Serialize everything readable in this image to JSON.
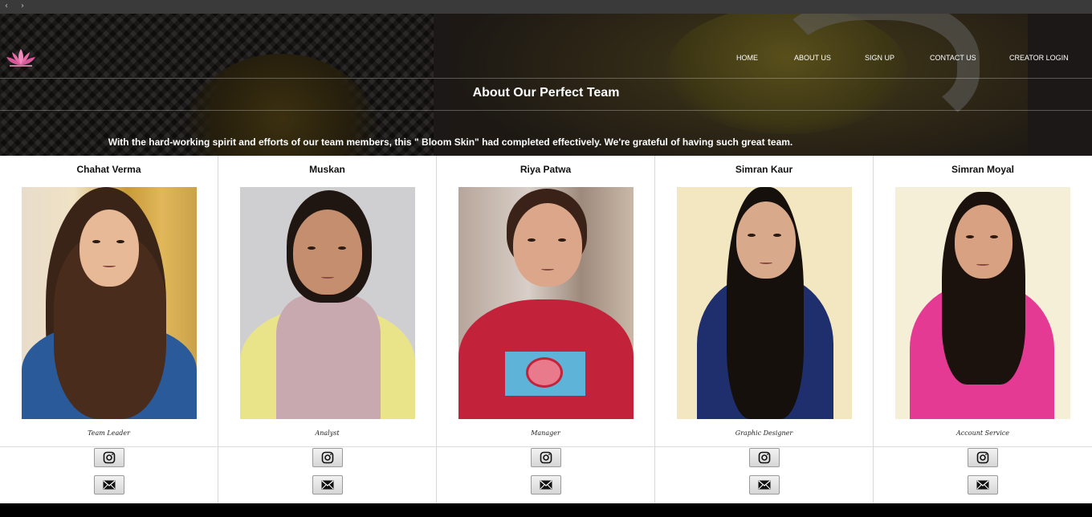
{
  "browser": {
    "back_glyph": "‹",
    "forward_glyph": "›"
  },
  "header": {
    "logo_icon": "lotus-icon",
    "nav": [
      {
        "label": "HOME"
      },
      {
        "label": "ABOUT US"
      },
      {
        "label": "SIGN UP"
      },
      {
        "label": "CONTACT US"
      },
      {
        "label": "CREATOR LOGIN"
      }
    ],
    "title": "About Our Perfect Team",
    "subtitle": "With the hard-working spirit and efforts of our team members, this \" Bloom Skin\" had completed effectively. We're grateful of having such great team."
  },
  "team": [
    {
      "name": "Chahat Verma",
      "role": "Team Leader"
    },
    {
      "name": "Muskan",
      "role": "Analyst"
    },
    {
      "name": "Riya Patwa",
      "role": "Manager"
    },
    {
      "name": "Simran Kaur",
      "role": "Graphic Designer"
    },
    {
      "name": "Simran Moyal",
      "role": "Account Service"
    }
  ],
  "icons": {
    "instagram": "instagram-icon",
    "mail": "envelope-icon"
  },
  "colors": {
    "accent_pink": "#e86aa8",
    "page_bg": "#ffffff",
    "hero_text": "#ffffff"
  }
}
